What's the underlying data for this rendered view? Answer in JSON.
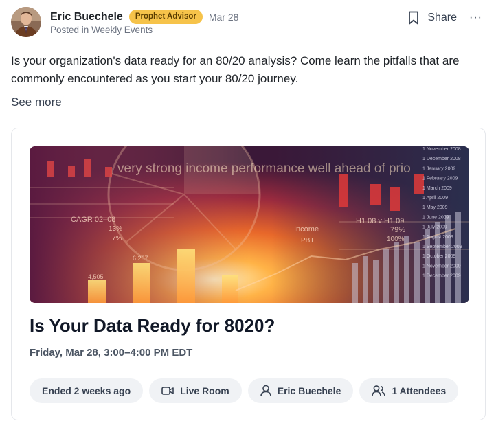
{
  "post": {
    "author": "Eric Buechele",
    "badge": "Prophet Advisor",
    "date": "Mar 28",
    "posted_in": "Posted in Weekly Events",
    "share_label": "Share",
    "more_label": "···",
    "body": "Is your organization's data ready for an 80/20 analysis? Come learn the pitfalls that are commonly encountered as you start your 80/20 journey.",
    "see_more": "See more"
  },
  "event": {
    "title": "Is Your Data Ready for 8020?",
    "time": "Friday, Mar 28, 3:00–4:00 PM EDT",
    "status": "Ended 2 weeks ago",
    "location": "Live Room",
    "host": "Eric Buechele",
    "attendees": "1 Attendees"
  },
  "banner": {
    "headline": "very strong income performance well ahead of prio",
    "labels": {
      "cagr": "CAGR 02–08",
      "h1": "H1 08 v H1 09",
      "income": "Income",
      "pbt": "PBT",
      "pct_79": "79%",
      "pct_13": "13%",
      "pct_7": "7%",
      "v4505": "4,505",
      "v6267": "6,267",
      "v100": "100%"
    },
    "dates": [
      "1 November 2008",
      "1 December 2008",
      "1 January 2009",
      "1 February 2009",
      "1 March 2009",
      "1 April 2009",
      "1 May 2009",
      "1 June 2009",
      "1 July 2009",
      "1 August 2009",
      "1 September 2009",
      "1 October 2009",
      "1 November 2009",
      "1 December 2009"
    ]
  },
  "colors": {
    "badge_bg": "#f6c34a",
    "chip_bg": "#f0f2f5",
    "text_dark": "#111827",
    "text_muted": "#6b7280"
  }
}
